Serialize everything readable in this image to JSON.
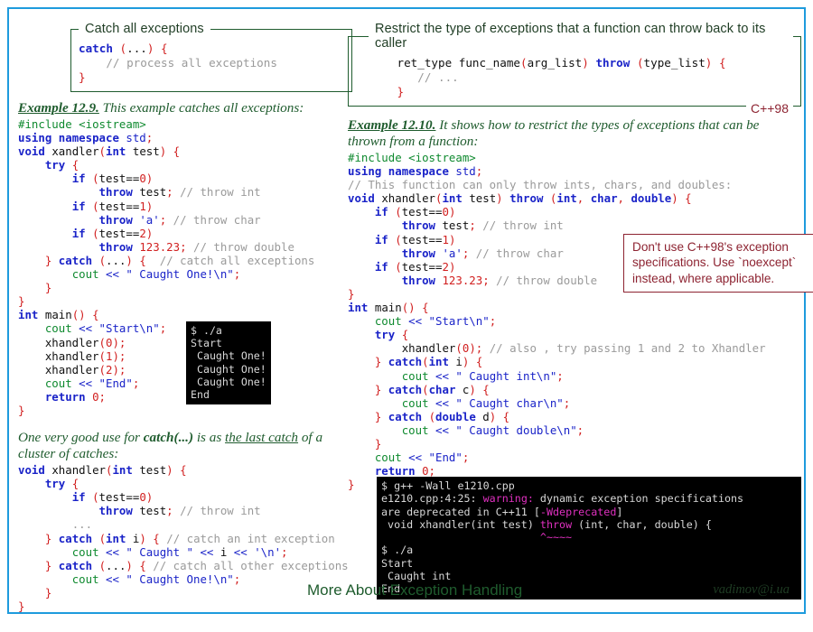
{
  "slide": {
    "footer_title": "More About Exception Handling",
    "footer_email": "vadimov@i.ua",
    "border_color": "#1e9bdd"
  },
  "left": {
    "box": {
      "legend": "Catch all exceptions",
      "code_lines": [
        "catch (...) {",
        "    // process all exceptions",
        "}"
      ]
    },
    "example_heading": {
      "label": "Example 12.9.",
      "text": " This example catches all exceptions:"
    },
    "code1": [
      "#include <iostream>",
      "using namespace std;",
      "void xandler(int test) {",
      "    try {",
      "        if (test==0)",
      "            throw test; // throw int",
      "        if (test==1)",
      "            throw 'a'; // throw char",
      "        if (test==2)",
      "            throw 123.23; // throw double",
      "    } catch (...) {  // catch all exceptions",
      "        cout << \" Caught One!\\n\";",
      "    }",
      "}",
      "int main() {",
      "    cout << \"Start\\n\";",
      "    xhandler(0);",
      "    xhandler(1);",
      "    xhandler(2);",
      "    cout << \"End\";",
      "    return 0;",
      "}"
    ],
    "terminal": [
      "$ ./a",
      "Start",
      " Caught One!",
      " Caught One!",
      " Caught One!",
      "End"
    ],
    "prose2_line1_a": "One very good use for ",
    "prose2_line1_b": "catch(...)",
    "prose2_line1_c": " is as ",
    "prose2_line1_d": "the last catch",
    "prose2_line1_e": " of a",
    "prose2_line2": "cluster of catches:",
    "code2": [
      "void xhandler(int test) {",
      "    try {",
      "        if (test==0)",
      "            throw test; // throw int",
      "        ...",
      "    } catch (int i) { // catch an int exception",
      "        cout << \" Caught \" << i << '\\n';",
      "    } catch (...) { // catch all other exceptions",
      "        cout << \" Caught One!\\n\";",
      "    }",
      "}"
    ]
  },
  "right": {
    "box": {
      "legend": "Restrict the type of exceptions that a function can throw back to its caller",
      "tag": "C++98",
      "code_lines": [
        "      ret_type func_name(arg_list) throw (type_list) {",
        "         // ...",
        "      }"
      ]
    },
    "example_heading": {
      "label": "Example 12.10.",
      "text": " It shows how to restrict the types of exceptions that can be"
    },
    "example_heading_line2": "thrown from a function:",
    "code1": [
      "#include <iostream>",
      "using namespace std;",
      "// This function can only throw ints, chars, and doubles:",
      "void xhandler(int test) throw (int, char, double) {",
      "    if (test==0)",
      "        throw test; // throw int",
      "    if (test==1)",
      "        throw 'a'; // throw char",
      "    if (test==2)",
      "        throw 123.23; // throw double",
      "}",
      "int main() {",
      "    cout << \"Start\\n\";",
      "    try {",
      "        xhandler(0); // also , try passing 1 and 2 to Xhandler",
      "    } catch(int i) {",
      "        cout << \" Caught int\\n\";",
      "    } catch(char c) {",
      "        cout << \" Caught char\\n\";",
      "    } catch (double d) {",
      "        cout << \" Caught double\\n\";",
      "    }",
      "    cout << \"End\";",
      "    return 0;",
      "}"
    ],
    "note": [
      "Don't use C++98's exception",
      "specifications. Use `noexcept`",
      "instead, where applicable."
    ],
    "terminal": {
      "line1": "$ g++ -Wall e1210.cpp",
      "line2_a": "e1210.cpp:4:25: ",
      "line2_warn": "warning:",
      "line2_b": " dynamic exception specifications",
      "line3_a": "are deprecated in C++11 [",
      "line3_warn": "-Wdeprecated",
      "line3_b": "]",
      "line4_a": " void xhandler(int test) ",
      "line4_warn": "throw",
      "line4_b": " (int, char, double) {",
      "line5_caret": "                         ^~~~~",
      "line6": "$ ./a",
      "line7": "Start",
      "line8": " Caught int",
      "line9": "End"
    }
  }
}
